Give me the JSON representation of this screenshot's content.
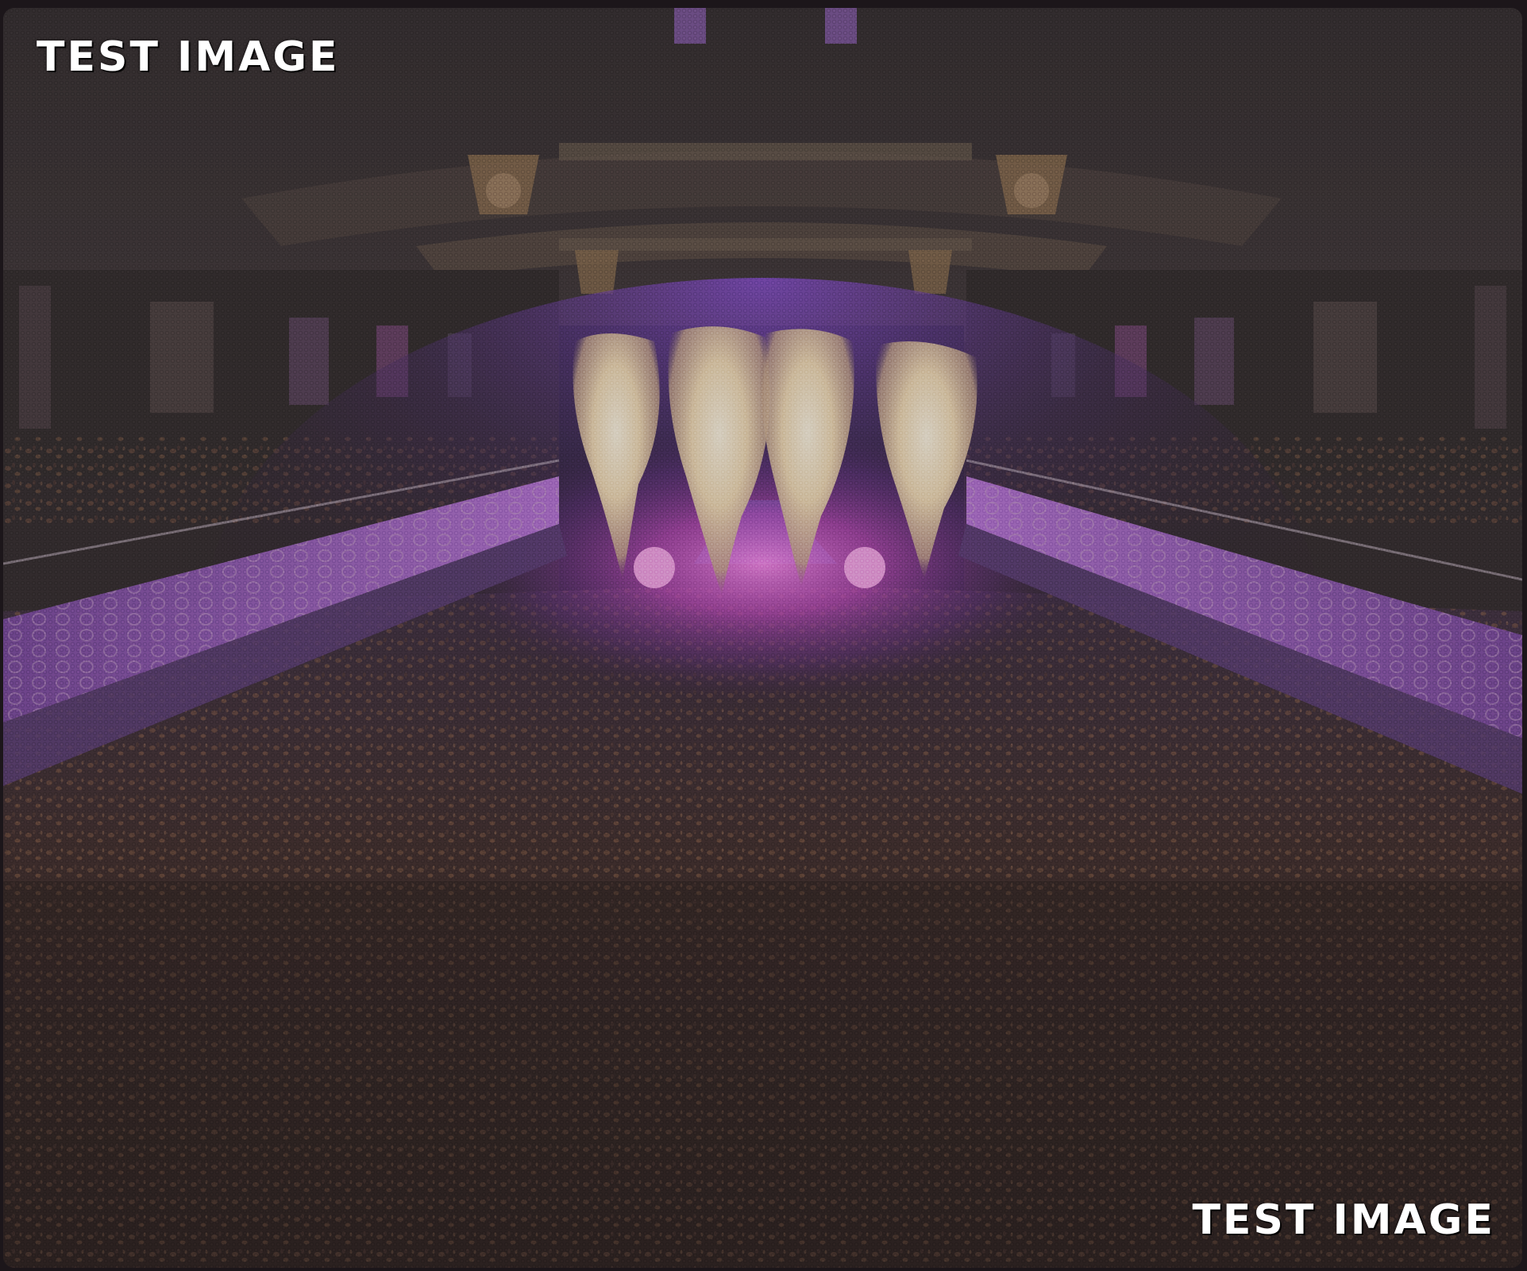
{
  "overlay_labels": {
    "top_left": "TEST IMAGE",
    "bottom_right": "TEST IMAGE"
  },
  "scene": {
    "description_colors": {
      "stage_light_pink": "#e04cd8",
      "stage_light_blue": "#3a9ff0",
      "smoke": "#f6e6cc",
      "balcony_purple": "#a05ad0",
      "crowd": "#3a2420"
    }
  }
}
